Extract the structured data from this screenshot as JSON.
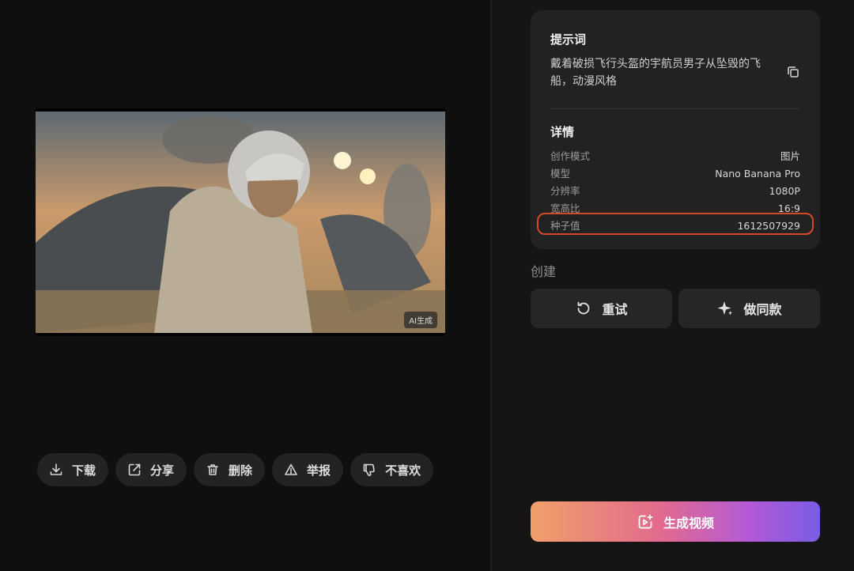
{
  "preview": {
    "badge": "AI生成"
  },
  "actions": [
    {
      "label": "下载",
      "icon": "download-icon"
    },
    {
      "label": "分享",
      "icon": "share-icon"
    },
    {
      "label": "删除",
      "icon": "trash-icon"
    },
    {
      "label": "举报",
      "icon": "warning-icon"
    },
    {
      "label": "不喜欢",
      "icon": "thumbs-down-icon"
    }
  ],
  "info": {
    "prompt_title": "提示词",
    "prompt_text": "戴着破损飞行头盔的宇航员男子从坠毁的飞船，动漫风格",
    "details_title": "详情",
    "details": [
      {
        "key": "创作模式",
        "value": "图片"
      },
      {
        "key": "模型",
        "value": "Nano Banana Pro"
      },
      {
        "key": "分辨率",
        "value": "1080P"
      },
      {
        "key": "宽高比",
        "value": "16:9"
      },
      {
        "key": "种子值",
        "value": "1612507929"
      }
    ]
  },
  "create": {
    "label": "创建",
    "retry": "重试",
    "same_style": "做同款"
  },
  "generate_video": "生成视频",
  "colors": {
    "highlight": "#d24a2a",
    "gradient_start": "#f0a06a",
    "gradient_end": "#7a5ce6"
  }
}
